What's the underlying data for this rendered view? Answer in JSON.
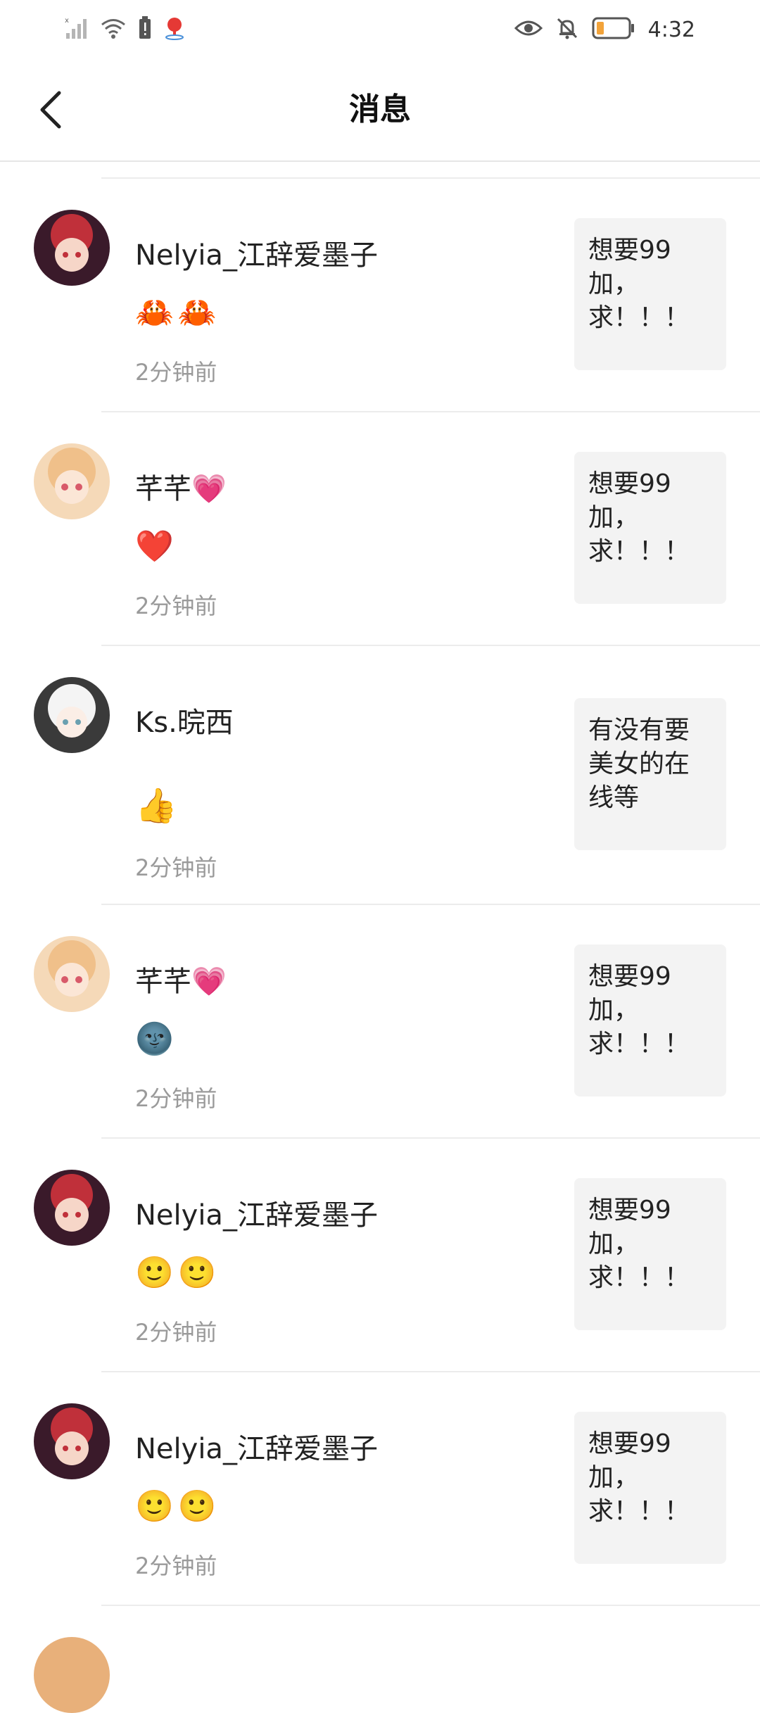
{
  "status_bar": {
    "time": "4:32"
  },
  "header": {
    "title": "消息"
  },
  "messages": [
    {
      "name": "Nelyia_江辞爱墨子",
      "emojis": [
        "🦀",
        "🦀"
      ],
      "time": "2分钟前",
      "preview": "想要99加，求！！！",
      "avatar_colors": [
        "#c0303a",
        "#3a1a2a"
      ]
    },
    {
      "name": "芊芊💗",
      "emojis": [
        "❤️"
      ],
      "time": "2分钟前",
      "preview": "想要99加，求！！！",
      "avatar_colors": [
        "#f0c08a",
        "#d85a6a"
      ]
    },
    {
      "name": "Ks.晥西",
      "emojis": [
        "👍"
      ],
      "time": "2分钟前",
      "preview": "有没有要美女的在线等",
      "avatar_colors": [
        "#f4f4f4",
        "#6aa0b0"
      ]
    },
    {
      "name": "芊芊💗",
      "emojis": [
        "🌚"
      ],
      "time": "2分钟前",
      "preview": "想要99加，求！！！",
      "avatar_colors": [
        "#f0c08a",
        "#d85a6a"
      ]
    },
    {
      "name": "Nelyia_江辞爱墨子",
      "emojis": [
        "🙂",
        "🙂"
      ],
      "time": "2分钟前",
      "preview": "想要99加，求！！！",
      "avatar_colors": [
        "#c0303a",
        "#3a1a2a"
      ]
    },
    {
      "name": "Nelyia_江辞爱墨子",
      "emojis": [
        "🙂",
        "🙂"
      ],
      "time": "2分钟前",
      "preview": "想要99加，求！！！",
      "avatar_colors": [
        "#c0303a",
        "#3a1a2a"
      ]
    }
  ]
}
